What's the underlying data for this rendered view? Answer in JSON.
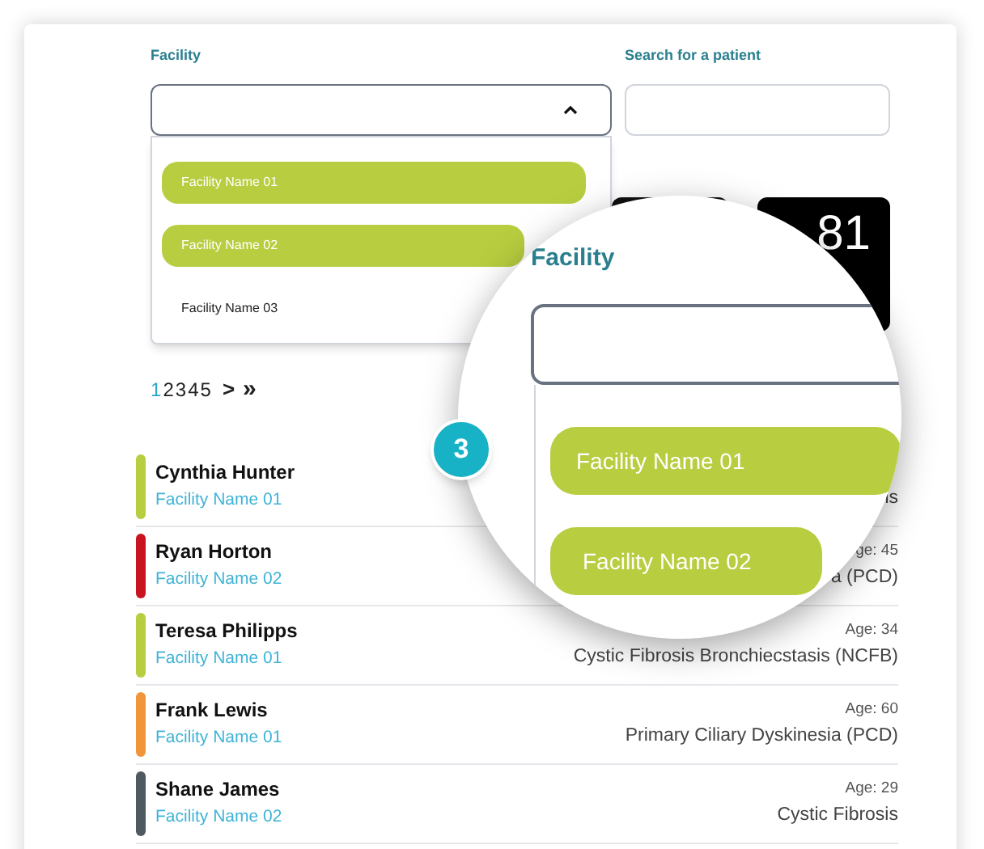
{
  "facility_filter": {
    "label": "Facility",
    "expanded": true,
    "options": [
      {
        "label": "Facility Name 01",
        "selected": true
      },
      {
        "label": "Facility Name 02",
        "selected": true
      },
      {
        "label": "Facility Name 03",
        "selected": false
      }
    ]
  },
  "search": {
    "label": "Search for a patient"
  },
  "stat_tile": {
    "value": "81"
  },
  "pagination": {
    "pages": [
      {
        "label": "1",
        "selected": true
      },
      {
        "label": "2",
        "selected": false
      },
      {
        "label": "3",
        "selected": false
      },
      {
        "label": "4",
        "selected": false
      },
      {
        "label": "5",
        "selected": false
      }
    ],
    "next": ">",
    "last": "»"
  },
  "patients": [
    {
      "name": "Cynthia Hunter",
      "facility": "Facility Name 01",
      "color": "#b8cd3f",
      "diagnosis": "is"
    },
    {
      "name": "Ryan Horton",
      "facility": "Facility Name 02",
      "color": "#c8141e",
      "age": "ge: 45",
      "diagnosis": "a (PCD)"
    },
    {
      "name": "Teresa Philipps",
      "facility": "Facility Name 01",
      "color": "#b8cd3f",
      "age": "Age: 34",
      "diagnosis": "Cystic Fibrosis Bronchiecstasis (NCFB)"
    },
    {
      "name": "Frank Lewis",
      "facility": "Facility Name 01",
      "color": "#f0953a",
      "age": "Age: 60",
      "diagnosis": "Primary Ciliary Dyskinesia (PCD)"
    },
    {
      "name": "Shane James",
      "facility": "Facility Name 02",
      "color": "#4f5a60",
      "age": "Age: 29",
      "diagnosis": "Cystic Fibrosis"
    }
  ],
  "magnifier": {
    "badge": "3",
    "label": "Facility",
    "options": [
      {
        "label": "Facility Name 01",
        "selected": true
      },
      {
        "label": "Facility Name 02",
        "selected": true
      }
    ]
  }
}
